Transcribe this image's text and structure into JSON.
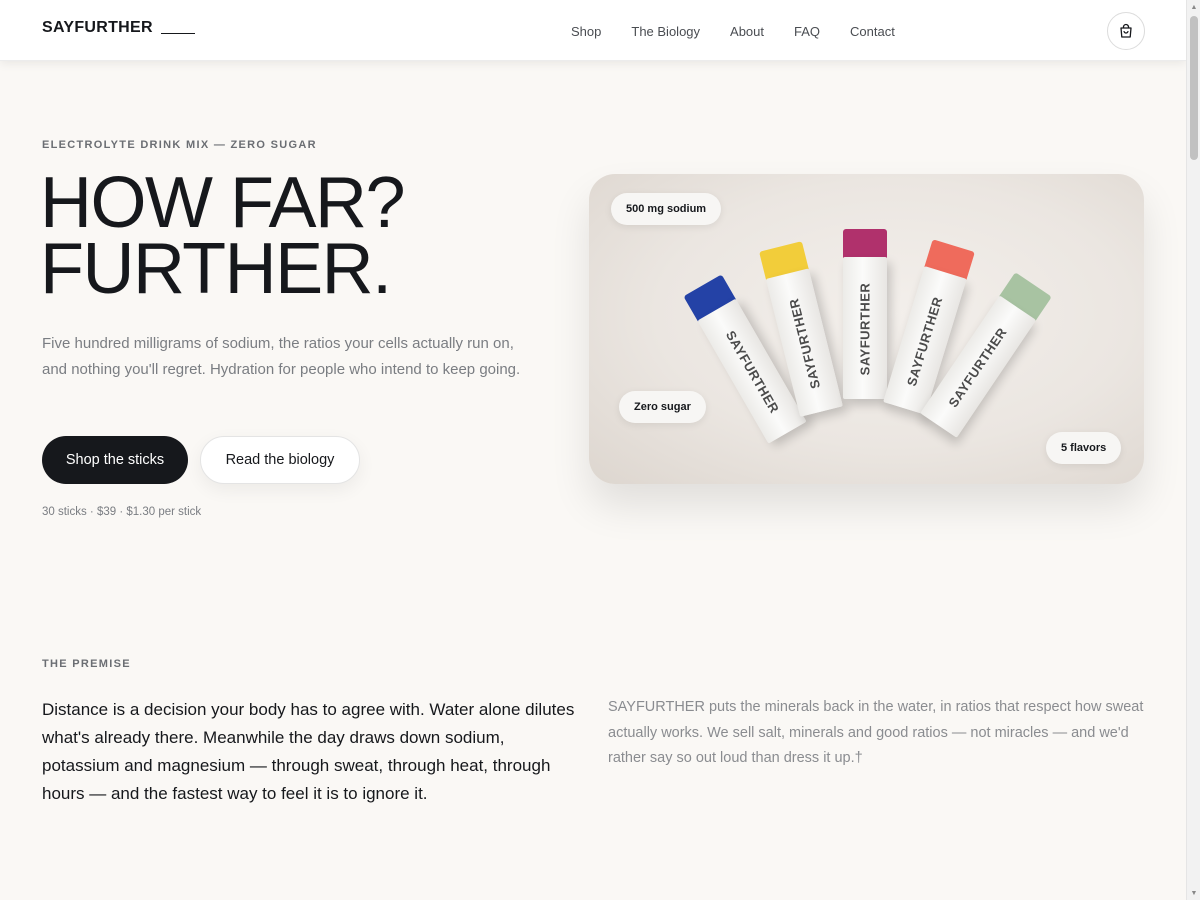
{
  "header": {
    "logo": "SAYFURTHER",
    "nav": [
      "Shop",
      "The Biology",
      "About",
      "FAQ",
      "Contact"
    ],
    "cart_icon": "shopping-bag-icon"
  },
  "hero": {
    "eyebrow": "ELECTROLYTE DRINK MIX — ZERO SUGAR",
    "title_line1": "HOW FAR?",
    "title_line2": "FURTHER.",
    "description": "Five hundred milligrams of sodium, the ratios your cells actually run on, and nothing you'll regret. Hydration for people who intend to keep going.",
    "primary_button": "Shop the sticks",
    "secondary_button": "Read the biology",
    "price_note": "30 sticks · $39 · $1.30 per stick",
    "image": {
      "chip_sodium": "500 mg sodium",
      "chip_sugar": "Zero sugar",
      "chip_flavors": "5 flavors",
      "stick_brand": "SAYFURTHER",
      "stick_colors": [
        "#2442a6",
        "#f2cd3a",
        "#b0316c",
        "#ef6b5c",
        "#a8c3a2"
      ]
    }
  },
  "premise": {
    "eyebrow": "THE PREMISE",
    "lead": "Distance is a decision your body has to agree with. Water alone dilutes what's already there. Meanwhile the day draws down sodium, potassium and magnesium — through sweat, through heat, through hours — and the fastest way to feel it is to ignore it.",
    "side": "SAYFURTHER puts the minerals back in the water, in ratios that respect how sweat actually works. We sell salt, minerals and good ratios — not miracles — and we'd rather say so out loud than dress it up.†"
  },
  "colors": {
    "background": "#faf8f5",
    "ink": "#16181c",
    "muted": "#7a7d82"
  }
}
